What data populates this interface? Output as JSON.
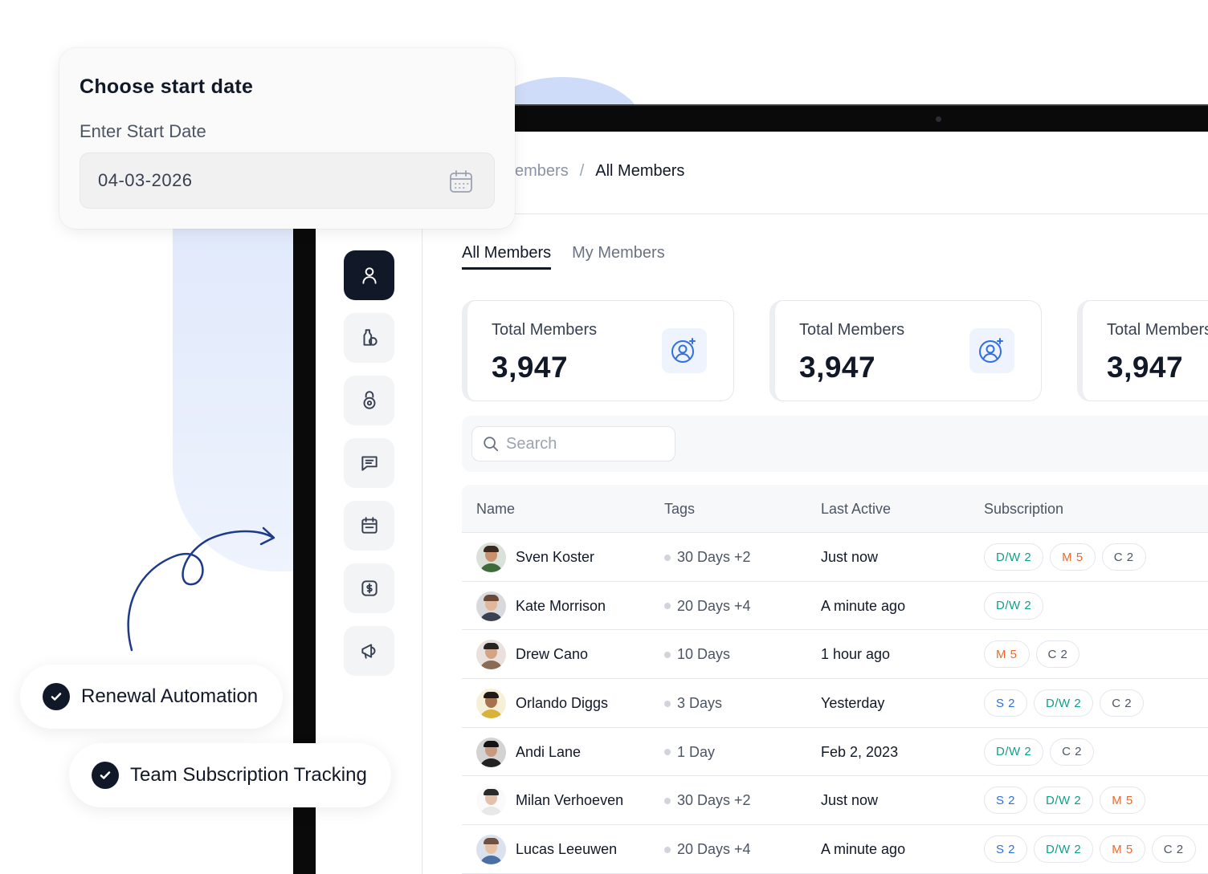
{
  "date_picker": {
    "title": "Choose start date",
    "label": "Enter Start Date",
    "value": "04-03-2026"
  },
  "breadcrumb": {
    "parent": "embers",
    "separator": "/",
    "current": "All Members"
  },
  "sidebar": {
    "items": [
      {
        "icon": "user-icon",
        "active": true
      },
      {
        "icon": "bottles-icon",
        "active": false
      },
      {
        "icon": "kettlebell-icon",
        "active": false
      },
      {
        "icon": "message-icon",
        "active": false
      },
      {
        "icon": "calendar-icon",
        "active": false
      },
      {
        "icon": "dollar-icon",
        "active": false
      },
      {
        "icon": "megaphone-icon",
        "active": false
      }
    ]
  },
  "tabs": [
    {
      "label": "All Members",
      "active": true
    },
    {
      "label": "My Members",
      "active": false
    }
  ],
  "stats": [
    {
      "title": "Total Members",
      "value": "3,947"
    },
    {
      "title": "Total Members",
      "value": "3,947"
    },
    {
      "title": "Total Members",
      "value": "3,947"
    }
  ],
  "search": {
    "placeholder": "Search",
    "value": ""
  },
  "table": {
    "headers": [
      "Name",
      "Tags",
      "Last Active",
      "Subscription"
    ],
    "rows": [
      {
        "name": "Sven Koster",
        "tag": "30 Days +2",
        "last_active": "Just now",
        "subscriptions": [
          "D/W 2",
          "M 5",
          "C 2"
        ]
      },
      {
        "name": "Kate Morrison",
        "tag": "20 Days +4",
        "last_active": "A minute ago",
        "subscriptions": [
          "D/W 2"
        ]
      },
      {
        "name": "Drew Cano",
        "tag": "10 Days",
        "last_active": "1 hour ago",
        "subscriptions": [
          "M 5",
          "C 2"
        ]
      },
      {
        "name": "Orlando Diggs",
        "tag": "3 Days",
        "last_active": "Yesterday",
        "subscriptions": [
          "S 2",
          "D/W 2",
          "C 2"
        ]
      },
      {
        "name": "Andi Lane",
        "tag": "1 Day",
        "last_active": "Feb 2, 2023",
        "subscriptions": [
          "D/W 2",
          "C 2"
        ]
      },
      {
        "name": "Milan Verhoeven",
        "tag": "30 Days +2",
        "last_active": "Just now",
        "subscriptions": [
          "S 2",
          "D/W 2",
          "M 5"
        ]
      },
      {
        "name": "Lucas Leeuwen",
        "tag": "20 Days +4",
        "last_active": "A minute ago",
        "subscriptions": [
          "S 2",
          "D/W 2",
          "M 5",
          "C 2"
        ]
      }
    ]
  },
  "badge_colors": {
    "S": "#2f6fe0",
    "D/W": "#0e9f8a",
    "M": "#ea6a2c",
    "C": "#4b5563"
  },
  "features": [
    {
      "label": "Renewal Automation"
    },
    {
      "label": "Team Subscription Tracking"
    }
  ],
  "colors": {
    "accent_dark": "#111827",
    "icon_blue": "#2f6fe0",
    "doodle": "#1e3a8a"
  }
}
